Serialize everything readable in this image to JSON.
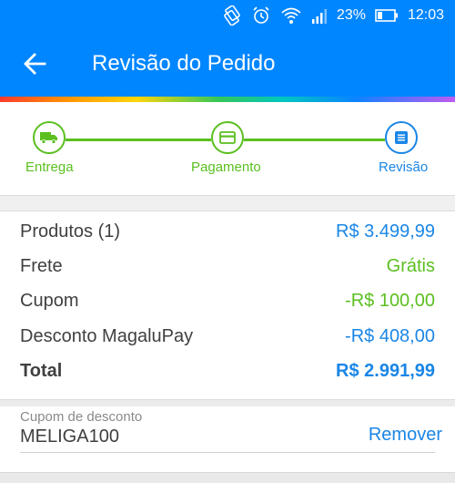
{
  "status_bar": {
    "icons": [
      "rotate-lock-icon",
      "alarm-icon",
      "wifi-icon",
      "signal-icon"
    ],
    "battery": "23%",
    "battery_icon": "battery-icon",
    "time": "12:03"
  },
  "app_bar": {
    "title": "Revisão do Pedido",
    "back_icon": "arrow-left-icon",
    "color": "#0086ff"
  },
  "stepper": {
    "steps": [
      {
        "label": "Entrega",
        "icon": "truck-icon",
        "state": "done"
      },
      {
        "label": "Pagamento",
        "icon": "card-icon",
        "state": "done"
      },
      {
        "label": "Revisão",
        "icon": "document-icon",
        "state": "current"
      }
    ],
    "colors": {
      "done": "#5bbf1f",
      "current": "#1a86e6"
    }
  },
  "summary": {
    "rows": [
      {
        "label": "Produtos (1)",
        "value": "R$ 3.499,99"
      },
      {
        "label": "Frete",
        "value": "Grátis"
      },
      {
        "label": "Cupom",
        "value": "-R$ 100,00"
      },
      {
        "label": "Desconto MagaluPay",
        "value": "-R$ 408,00"
      }
    ],
    "total": {
      "label": "Total",
      "value": "R$ 2.991,99"
    }
  },
  "coupon": {
    "label": "Cupom de desconto",
    "value": "MELIGA100",
    "remove_label": "Remover"
  }
}
